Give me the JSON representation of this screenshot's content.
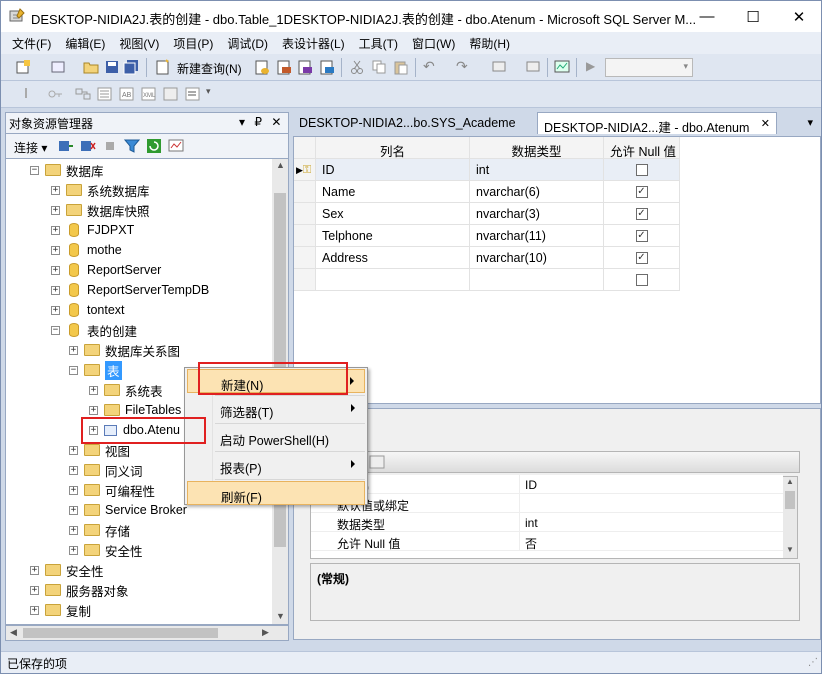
{
  "window": {
    "title": "DESKTOP-NIDIA2J.表的创建 - dbo.Table_1DESKTOP-NIDIA2J.表的创建 - dbo.Atenum - Microsoft SQL Server M...",
    "minimize": "—",
    "maximize": "☐",
    "close": "✕"
  },
  "menu": [
    "文件(F)",
    "编辑(E)",
    "视图(V)",
    "项目(P)",
    "调试(D)",
    "表设计器(L)",
    "工具(T)",
    "窗口(W)",
    "帮助(H)"
  ],
  "toolbar": {
    "new_query": "新建查询(N)"
  },
  "object_explorer": {
    "title": "对象资源管理器",
    "pin": "▾ ₽ ✕",
    "connect": "连接 ▾",
    "tree": [
      {
        "label": "数据库",
        "sign": "−",
        "indent": 0,
        "type": "folder"
      },
      {
        "label": "系统数据库",
        "sign": "+",
        "indent": 1,
        "type": "folder"
      },
      {
        "label": "数据库快照",
        "sign": "+",
        "indent": 1,
        "type": "folder"
      },
      {
        "label": "FJDPXT",
        "sign": "+",
        "indent": 1,
        "type": "db"
      },
      {
        "label": "mothe",
        "sign": "+",
        "indent": 1,
        "type": "db"
      },
      {
        "label": "ReportServer",
        "sign": "+",
        "indent": 1,
        "type": "db"
      },
      {
        "label": "ReportServerTempDB",
        "sign": "+",
        "indent": 1,
        "type": "db"
      },
      {
        "label": "tontext",
        "sign": "+",
        "indent": 1,
        "type": "db"
      },
      {
        "label": "表的创建",
        "sign": "−",
        "indent": 1,
        "type": "db"
      },
      {
        "label": "数据库关系图",
        "sign": "+",
        "indent": 2,
        "type": "folder"
      },
      {
        "label": "表",
        "sign": "−",
        "indent": 2,
        "type": "folder",
        "selected": true
      },
      {
        "label": "系统表",
        "sign": "+",
        "indent": 3,
        "type": "folder"
      },
      {
        "label": "FileTables",
        "sign": "+",
        "indent": 3,
        "type": "folder"
      },
      {
        "label": "dbo.Atenu",
        "sign": "+",
        "indent": 3,
        "type": "table"
      },
      {
        "label": "视图",
        "sign": "+",
        "indent": 2,
        "type": "folder"
      },
      {
        "label": "同义词",
        "sign": "+",
        "indent": 2,
        "type": "folder"
      },
      {
        "label": "可编程性",
        "sign": "+",
        "indent": 2,
        "type": "folder"
      },
      {
        "label": "Service Broker",
        "sign": "+",
        "indent": 2,
        "type": "folder"
      },
      {
        "label": "存储",
        "sign": "+",
        "indent": 2,
        "type": "folder"
      },
      {
        "label": "安全性",
        "sign": "+",
        "indent": 2,
        "type": "folder"
      },
      {
        "label": "安全性",
        "sign": "+",
        "indent": 0,
        "type": "folder"
      },
      {
        "label": "服务器对象",
        "sign": "+",
        "indent": 0,
        "type": "folder"
      },
      {
        "label": "复制",
        "sign": "+",
        "indent": 0,
        "type": "folder"
      }
    ]
  },
  "tabs": [
    {
      "label": "DESKTOP-NIDIA2...bo.SYS_Academe",
      "active": false
    },
    {
      "label": "DESKTOP-NIDIA2...建 - dbo.Atenum",
      "active": true
    }
  ],
  "tab_close": "✕",
  "tab_dropdown": "▾",
  "designer": {
    "headers": [
      "列名",
      "数据类型",
      "允许 Null 值"
    ],
    "rows": [
      {
        "name": "ID",
        "type": "int",
        "null": false,
        "key": true
      },
      {
        "name": "Name",
        "type": "nvarchar(6)",
        "null": true
      },
      {
        "name": "Sex",
        "type": "nvarchar(3)",
        "null": true
      },
      {
        "name": "Telphone",
        "type": "nvarchar(11)",
        "null": true
      },
      {
        "name": "Address",
        "type": "nvarchar(10)",
        "null": true
      },
      {
        "name": "",
        "type": "",
        "null": false
      }
    ]
  },
  "properties": {
    "rows": [
      {
        "label": "(名称)",
        "value": "ID"
      },
      {
        "label": "默认值或绑定",
        "value": ""
      },
      {
        "label": "数据类型",
        "value": "int"
      },
      {
        "label": "允许 Null 值",
        "value": "否"
      }
    ],
    "description": "(常规)"
  },
  "context_menu": {
    "items": [
      {
        "label": "新建(N)",
        "submenu": true
      },
      {
        "label": "筛选器(T)",
        "submenu": true
      },
      {
        "label": "启动 PowerShell(H)",
        "submenu": false
      },
      {
        "label": "报表(P)",
        "submenu": true
      },
      {
        "label": "刷新(F)",
        "submenu": false
      }
    ]
  },
  "status": {
    "text": "已保存的项"
  },
  "colors": {
    "highlight": "#e02020",
    "selection": "#3399ff",
    "menu_hover": "#fce3b3"
  }
}
